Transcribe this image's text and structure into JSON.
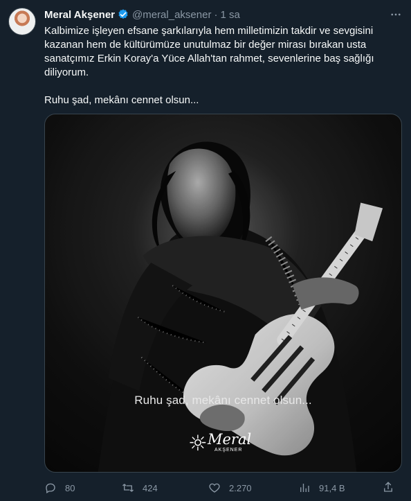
{
  "tweet": {
    "author_name": "Meral Akşener",
    "author_handle": "@meral_aksener",
    "separator": "·",
    "time": "1 sa",
    "text_paragraph_1": "Kalbimize işleyen efsane şarkılarıyla hem milletimizin takdir ve sevgisini kazanan hem de kültürümüze unutulmaz bir değer mirası bırakan usta sanatçımız Erkin Koray'a Yüce Allah'tan rahmet, sevenlerine baş sağlığı diliyorum.",
    "text_paragraph_2": "Ruhu şad, mekânı cennet olsun...",
    "media": {
      "caption": "Ruhu şad, mekânı cennet olsun...",
      "signature_name": "Meral",
      "signature_surname": "AKŞENER"
    },
    "metrics": {
      "replies": "80",
      "retweets": "424",
      "likes": "2.270",
      "views": "91,4 B"
    }
  },
  "icons": [
    "verified-icon",
    "more-icon",
    "reply-icon",
    "retweet-icon",
    "like-icon",
    "views-icon",
    "share-icon"
  ],
  "colors": {
    "background": "#15202b",
    "text": "#f7f9f9",
    "secondary_text": "#8b98a5",
    "accent": "#1d9bf0"
  }
}
